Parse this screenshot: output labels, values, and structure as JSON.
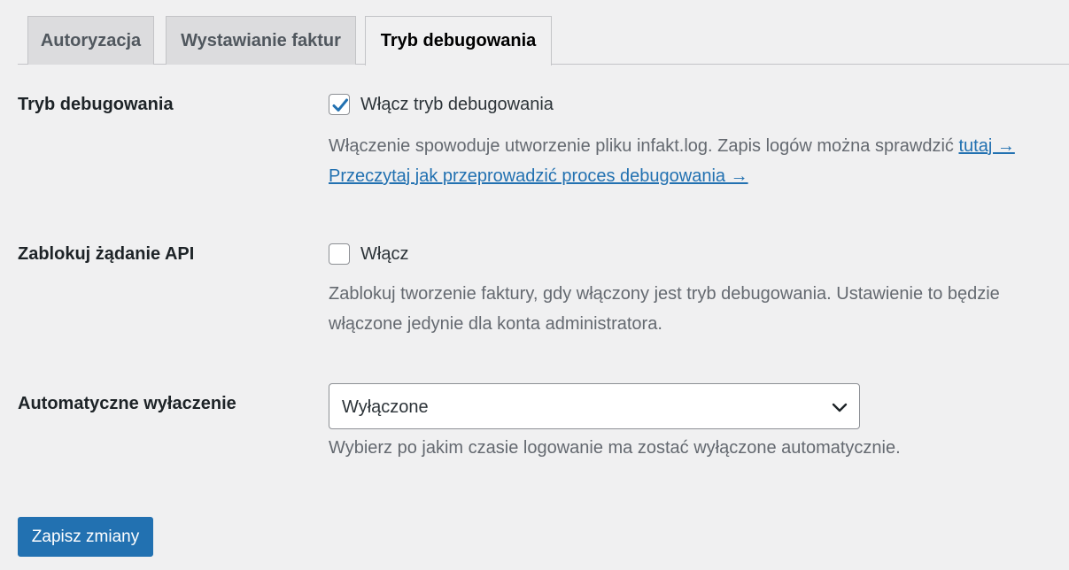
{
  "tabs": [
    {
      "label": "Autoryzacja",
      "active": false
    },
    {
      "label": "Wystawianie faktur",
      "active": false
    },
    {
      "label": "Tryb debugowania",
      "active": true
    }
  ],
  "debug_mode": {
    "label": "Tryb debugowania",
    "checkbox_label": "Włącz tryb debugowania",
    "checked": true,
    "description": "Włączenie spowoduje utworzenie pliku infakt.log. Zapis logów można sprawdzić ",
    "link_here": "tutaj →",
    "link_howto": "Przeczytaj jak przeprowadzić proces debugowania →"
  },
  "block_api": {
    "label": "Zablokuj żądanie API",
    "checkbox_label": "Włącz",
    "checked": false,
    "description_line1": "Zablokuj tworzenie faktury, gdy włączony jest tryb debugowania. Ustawienie to będzie",
    "description_line2": "włączone jedynie dla konta administratora."
  },
  "auto_disable": {
    "label": "Automatyczne wyłaczenie",
    "selected": "Wyłączone",
    "description": "Wybierz po jakim czasie logowanie ma zostać wyłączone automatycznie."
  },
  "save_button": {
    "label": "Zapisz zmiany"
  },
  "colors": {
    "accent": "#2271b1",
    "background": "#f0f0f1",
    "text": "#1d2327",
    "description": "#646970"
  }
}
